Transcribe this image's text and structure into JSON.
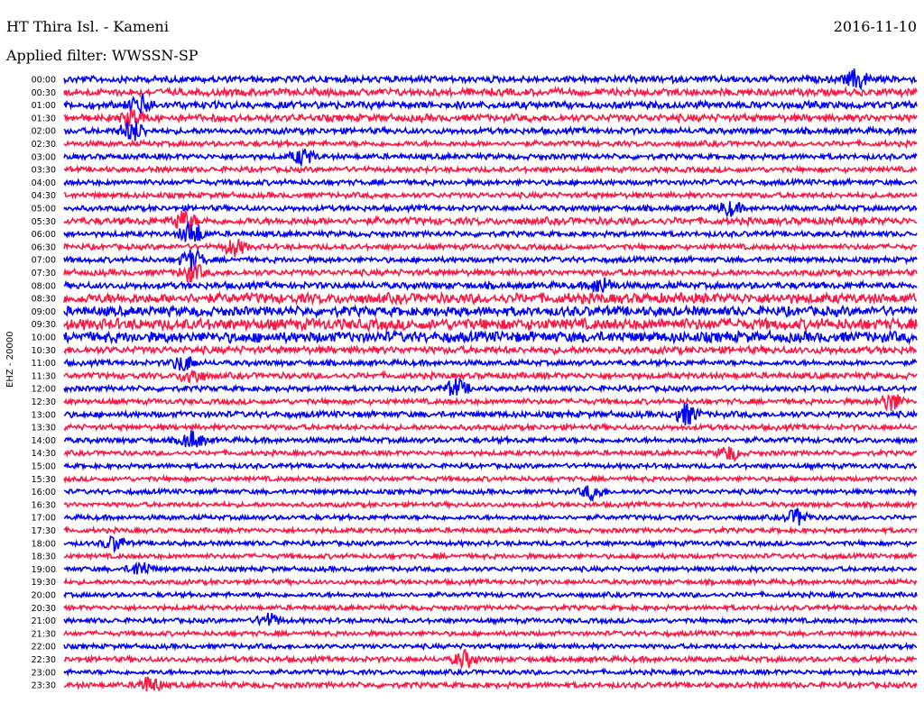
{
  "header": {
    "station": "HT Thira Isl. - Kameni",
    "date": "2016-11-10",
    "filter": "Applied filter: WWSSN-SP"
  },
  "channel": "EHZ - 20000",
  "colors": {
    "series_a": "#0000ff",
    "series_b": "#ff1744"
  },
  "chart_data": {
    "type": "line",
    "title": "HT Thira Isl. - Kameni",
    "subtitle": "Applied filter: WWSSN-SP",
    "ylabel": "EHZ - 20000",
    "xlabel": "",
    "row_interval_minutes": 30,
    "rows": [
      {
        "label": "00:00",
        "color": "blue",
        "noise": 0.55,
        "events": [
          {
            "t": 0.93,
            "a": 1.4
          }
        ]
      },
      {
        "label": "00:30",
        "color": "red",
        "noise": 0.6,
        "events": []
      },
      {
        "label": "01:00",
        "color": "blue",
        "noise": 0.6,
        "events": [
          {
            "t": 0.09,
            "a": 1.3
          }
        ]
      },
      {
        "label": "01:30",
        "color": "red",
        "noise": 0.6,
        "events": [
          {
            "t": 0.08,
            "a": 1.2
          }
        ]
      },
      {
        "label": "02:00",
        "color": "blue",
        "noise": 0.5,
        "events": [
          {
            "t": 0.08,
            "a": 1.6
          }
        ]
      },
      {
        "label": "02:30",
        "color": "red",
        "noise": 0.45,
        "events": []
      },
      {
        "label": "03:00",
        "color": "blue",
        "noise": 0.45,
        "events": [
          {
            "t": 0.28,
            "a": 1.2
          }
        ]
      },
      {
        "label": "03:30",
        "color": "red",
        "noise": 0.45,
        "events": []
      },
      {
        "label": "04:00",
        "color": "blue",
        "noise": 0.45,
        "events": []
      },
      {
        "label": "04:30",
        "color": "red",
        "noise": 0.45,
        "events": []
      },
      {
        "label": "05:00",
        "color": "blue",
        "noise": 0.45,
        "events": [
          {
            "t": 0.78,
            "a": 1.0
          }
        ]
      },
      {
        "label": "05:30",
        "color": "red",
        "noise": 0.6,
        "events": [
          {
            "t": 0.14,
            "a": 1.4
          }
        ]
      },
      {
        "label": "06:00",
        "color": "blue",
        "noise": 0.45,
        "events": [
          {
            "t": 0.15,
            "a": 1.8
          }
        ]
      },
      {
        "label": "06:30",
        "color": "red",
        "noise": 0.45,
        "events": [
          {
            "t": 0.2,
            "a": 1.2
          }
        ]
      },
      {
        "label": "07:00",
        "color": "blue",
        "noise": 0.45,
        "events": [
          {
            "t": 0.15,
            "a": 1.6
          }
        ]
      },
      {
        "label": "07:30",
        "color": "red",
        "noise": 0.5,
        "events": [
          {
            "t": 0.15,
            "a": 1.3
          }
        ]
      },
      {
        "label": "08:00",
        "color": "blue",
        "noise": 0.55,
        "events": [
          {
            "t": 0.63,
            "a": 1.2
          }
        ]
      },
      {
        "label": "08:30",
        "color": "red",
        "noise": 0.85,
        "events": []
      },
      {
        "label": "09:00",
        "color": "blue",
        "noise": 0.8,
        "events": []
      },
      {
        "label": "09:30",
        "color": "red",
        "noise": 0.95,
        "events": []
      },
      {
        "label": "10:00",
        "color": "blue",
        "noise": 0.9,
        "events": []
      },
      {
        "label": "10:30",
        "color": "red",
        "noise": 0.6,
        "events": []
      },
      {
        "label": "11:00",
        "color": "blue",
        "noise": 0.45,
        "events": [
          {
            "t": 0.14,
            "a": 1.2
          }
        ]
      },
      {
        "label": "11:30",
        "color": "red",
        "noise": 0.5,
        "events": [
          {
            "t": 0.15,
            "a": 1.2
          }
        ]
      },
      {
        "label": "12:00",
        "color": "blue",
        "noise": 0.45,
        "events": [
          {
            "t": 0.46,
            "a": 1.3
          }
        ]
      },
      {
        "label": "12:30",
        "color": "red",
        "noise": 0.45,
        "events": [
          {
            "t": 0.97,
            "a": 1.4
          }
        ]
      },
      {
        "label": "13:00",
        "color": "blue",
        "noise": 0.5,
        "events": [
          {
            "t": 0.73,
            "a": 1.5
          }
        ]
      },
      {
        "label": "13:30",
        "color": "red",
        "noise": 0.45,
        "events": []
      },
      {
        "label": "14:00",
        "color": "blue",
        "noise": 0.45,
        "events": [
          {
            "t": 0.15,
            "a": 1.3
          }
        ]
      },
      {
        "label": "14:30",
        "color": "red",
        "noise": 0.4,
        "events": [
          {
            "t": 0.78,
            "a": 1.1
          }
        ]
      },
      {
        "label": "15:00",
        "color": "blue",
        "noise": 0.4,
        "events": []
      },
      {
        "label": "15:30",
        "color": "red",
        "noise": 0.4,
        "events": []
      },
      {
        "label": "16:00",
        "color": "blue",
        "noise": 0.4,
        "events": [
          {
            "t": 0.62,
            "a": 1.1
          }
        ]
      },
      {
        "label": "16:30",
        "color": "red",
        "noise": 0.4,
        "events": []
      },
      {
        "label": "17:00",
        "color": "blue",
        "noise": 0.4,
        "events": [
          {
            "t": 0.86,
            "a": 1.2
          }
        ]
      },
      {
        "label": "17:30",
        "color": "red",
        "noise": 0.4,
        "events": []
      },
      {
        "label": "18:00",
        "color": "blue",
        "noise": 0.4,
        "events": [
          {
            "t": 0.06,
            "a": 1.1
          }
        ]
      },
      {
        "label": "18:30",
        "color": "red",
        "noise": 0.4,
        "events": []
      },
      {
        "label": "19:00",
        "color": "blue",
        "noise": 0.4,
        "events": [
          {
            "t": 0.09,
            "a": 1.1
          }
        ]
      },
      {
        "label": "19:30",
        "color": "red",
        "noise": 0.4,
        "events": []
      },
      {
        "label": "20:00",
        "color": "blue",
        "noise": 0.4,
        "events": []
      },
      {
        "label": "20:30",
        "color": "red",
        "noise": 0.4,
        "events": []
      },
      {
        "label": "21:00",
        "color": "blue",
        "noise": 0.4,
        "events": [
          {
            "t": 0.24,
            "a": 1.0
          }
        ]
      },
      {
        "label": "21:30",
        "color": "red",
        "noise": 0.4,
        "events": []
      },
      {
        "label": "22:00",
        "color": "blue",
        "noise": 0.4,
        "events": []
      },
      {
        "label": "22:30",
        "color": "red",
        "noise": 0.45,
        "events": [
          {
            "t": 0.47,
            "a": 1.2
          }
        ]
      },
      {
        "label": "23:00",
        "color": "blue",
        "noise": 0.4,
        "events": []
      },
      {
        "label": "23:30",
        "color": "red",
        "noise": 0.45,
        "events": [
          {
            "t": 0.1,
            "a": 1.2
          }
        ]
      }
    ]
  }
}
